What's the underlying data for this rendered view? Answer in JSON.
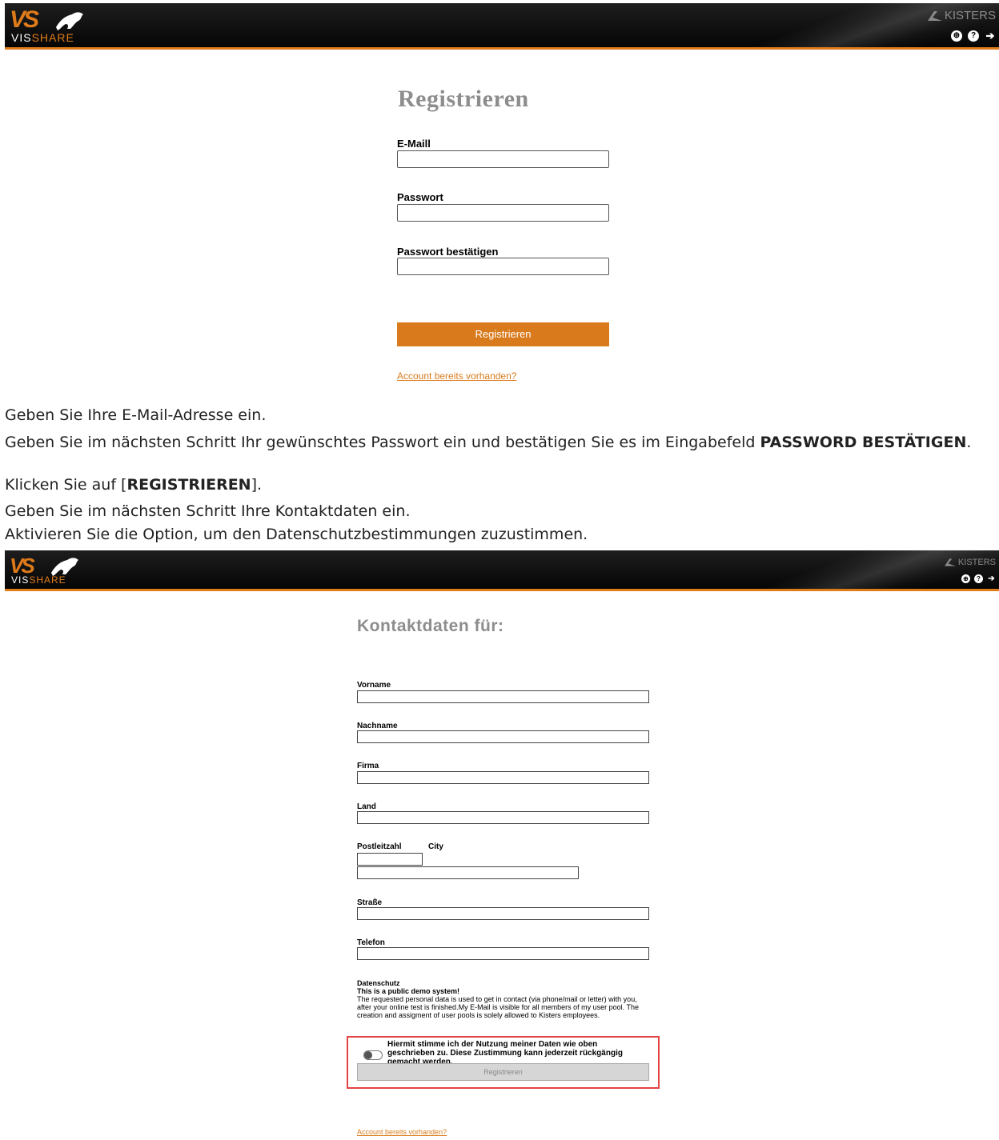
{
  "header": {
    "logo_short": "VS",
    "logo_name_a": "VIS",
    "logo_name_b": "SHARE",
    "kisters_label": "KISTERS",
    "icons": [
      "globe-icon",
      "help-icon",
      "login-icon"
    ]
  },
  "registration": {
    "title": "Registrieren",
    "email_label": "E-Maill",
    "password_label": "Passwort",
    "password_confirm_label": "Passwort bestätigen",
    "submit_label": "Registrieren",
    "login_link": "Account bereits vorhanden?"
  },
  "instructions": {
    "line1": "Geben Sie Ihre E-Mail-Adresse ein.",
    "line2_text": "Geben Sie im nächsten Schritt Ihr gewünschtes Passwort ein und bestätigen Sie es im Eingabefeld ",
    "line2_bold": "PASSWORD BESTÄTIGEN",
    "line2_end": ".",
    "line3_text": "Klicken Sie auf [",
    "line3_bold": "REGISTRIEREN",
    "line3_end": "].",
    "line4": "Geben Sie im nächsten Schritt Ihre Kontaktdaten ein.",
    "line5": "Aktivieren Sie die Option, um den Datenschutzbestimmungen zuzustimmen."
  },
  "contact": {
    "title": "Kontaktdaten für:",
    "firstname_label": "Vorname",
    "lastname_label": "Nachname",
    "company_label": "Firma",
    "country_label": "Land",
    "zip_label": "Postleitzahl",
    "city_label": "City",
    "street_label": "Straße",
    "phone_label": "Telefon",
    "privacy_heading": "Datenschutz",
    "privacy_subheading": "This is a public demo system!",
    "privacy_text": "The requested personal data is used to get in contact (via phone/mail or letter) with you, after your online test is finished.My E-Mail is visible for all members of my user pool. The creation and assigment of user pools is solely allowed to Kisters employees.",
    "consent_text": "Hiermit stimme ich der Nutzung meiner Daten wie oben geschrieben zu. Diese Zustimmung kann jederzeit rückgängig gemacht werden.",
    "consent_checked": false,
    "submit_label": "Registrieren",
    "login_link": "Account bereits vorhanden?"
  },
  "colors": {
    "accent": "#d97b1c",
    "header_bg": "#111111",
    "highlight": "#e24545",
    "title_grey": "#8d8d8d"
  }
}
